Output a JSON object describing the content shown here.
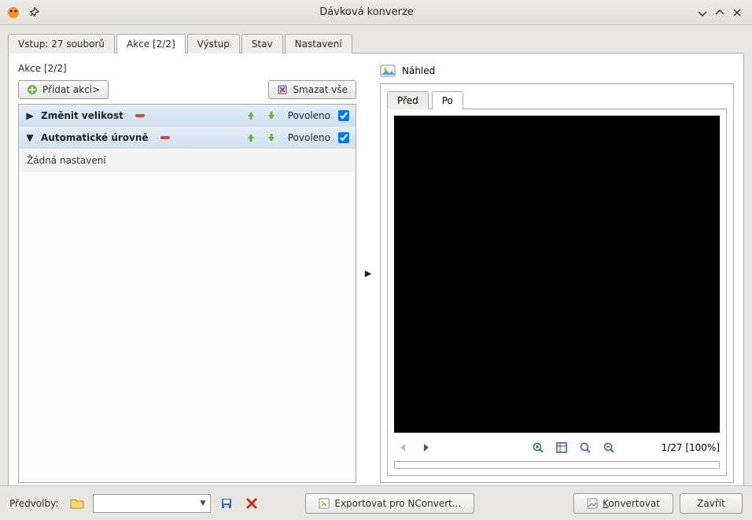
{
  "window": {
    "title": "Dávková konverze"
  },
  "tabs": {
    "input": "Vstup: 27 souborů",
    "actions": "Akce [2/2]",
    "output": "Výstup",
    "status": "Stav",
    "settings": "Nastavení",
    "selected": "actions"
  },
  "actions": {
    "section_title": "Akce [2/2]",
    "add_button": "Přidat akci>",
    "clear_button": "Smazat vše",
    "no_settings": "Žádná nastavení",
    "status_enabled": "Povoleno",
    "items": [
      {
        "name": "Změnit velikost",
        "expanded": false,
        "checked": true
      },
      {
        "name": "Automatické úrovně",
        "expanded": true,
        "checked": true
      }
    ]
  },
  "preview": {
    "label": "Náhled",
    "tab_before": "Před",
    "tab_after": "Po",
    "selected_tab": "after",
    "counter": "1/27 [100%]"
  },
  "bottom": {
    "presets_label": "Předvolby:",
    "preset_value": "",
    "export_button": "Exportovat pro NConvert...",
    "convert_button": "Konvertovat",
    "close_button": "Zavřít"
  }
}
